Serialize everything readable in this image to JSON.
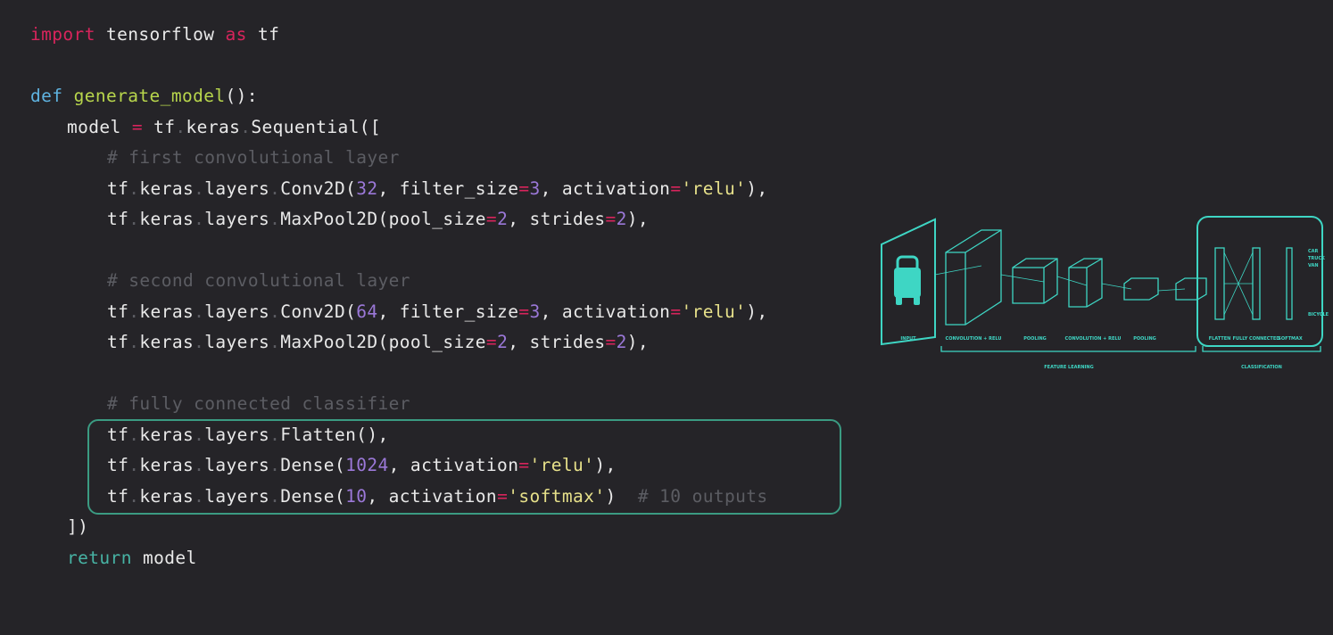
{
  "code": {
    "import_kw": "import",
    "import_mod": " tensorflow ",
    "import_as": "as",
    "import_alias": " tf",
    "def_kw": "def",
    "fn_name": "generate_model",
    "fn_sig": "():",
    "model_var": "model ",
    "model_eq": "=",
    "model_tf": " tf",
    "model_keras": "keras",
    "model_seq": "Sequential([",
    "c1": "# first convolutional layer",
    "c2": "# second convolutional layer",
    "c3": "# fully connected classifier",
    "tf": "tf",
    "keras": "keras",
    "layers": "layers",
    "conv2d": "Conv2D(",
    "maxpool": "MaxPool2D(",
    "flatten": "Flatten(),",
    "dense": "Dense(",
    "n32": "32",
    "n64": "64",
    "n2": "2",
    "n3": "3",
    "n1024": "1024",
    "n10": "10",
    "filter_size": ", filter_size",
    "activation": ", activation",
    "pool_size": "pool_size",
    "strides": ", strides",
    "relu": "'relu'",
    "relu_close": "),",
    "softmax": "'softmax'",
    "paren_close": "),",
    "paren_only": ")",
    "out_comment": "# 10 outputs",
    "close": "])",
    "return_kw": "return",
    "return_val": " model"
  },
  "diagram": {
    "labels": [
      "INPUT",
      "CONVOLUTION + RELU",
      "POOLING",
      "CONVOLUTION + RELU",
      "POOLING",
      "FLATTEN",
      "FULLY CONNECTED",
      "SOFTMAX"
    ],
    "groups": [
      "FEATURE LEARNING",
      "CLASSIFICATION"
    ],
    "outputs": [
      "CAR",
      "TRUCK",
      "VAN",
      "BICYCLE"
    ],
    "accent": "#3ed6c4"
  }
}
